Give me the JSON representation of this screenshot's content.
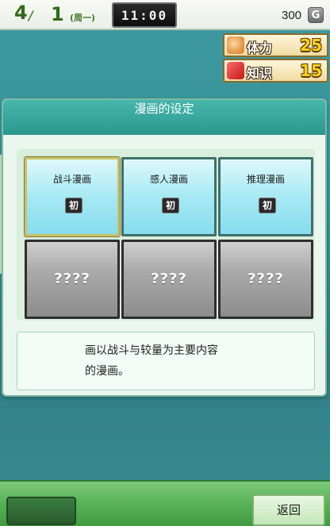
{
  "status": {
    "month": "4",
    "month_sep": "/",
    "week": "1",
    "weekday": "(周一)",
    "time": "11:00",
    "money": "300",
    "money_icon": "G"
  },
  "stats": {
    "stamina": {
      "label": "体力",
      "value": "25",
      "icon": "stamina-icon"
    },
    "knowledge": {
      "label": "知识",
      "value": "15",
      "icon": "book-icon"
    }
  },
  "dialog": {
    "title": "漫画的设定",
    "cards": [
      {
        "title": "战斗漫画",
        "badge": "初",
        "locked": false,
        "selected": true
      },
      {
        "title": "感人漫画",
        "badge": "初",
        "locked": false,
        "selected": false
      },
      {
        "title": "推理漫画",
        "badge": "初",
        "locked": false,
        "selected": false
      },
      {
        "title": "????",
        "locked": true
      },
      {
        "title": "????",
        "locked": true
      },
      {
        "title": "????",
        "locked": true
      }
    ],
    "description": [
      "画以战斗与较量为主要内容",
      "的漫画。"
    ]
  },
  "footer": {
    "back_label": "返回"
  },
  "colors": {
    "accent": "#2a978f",
    "bottom_bar": "#58b257",
    "stat_value": "#ffd21a"
  }
}
